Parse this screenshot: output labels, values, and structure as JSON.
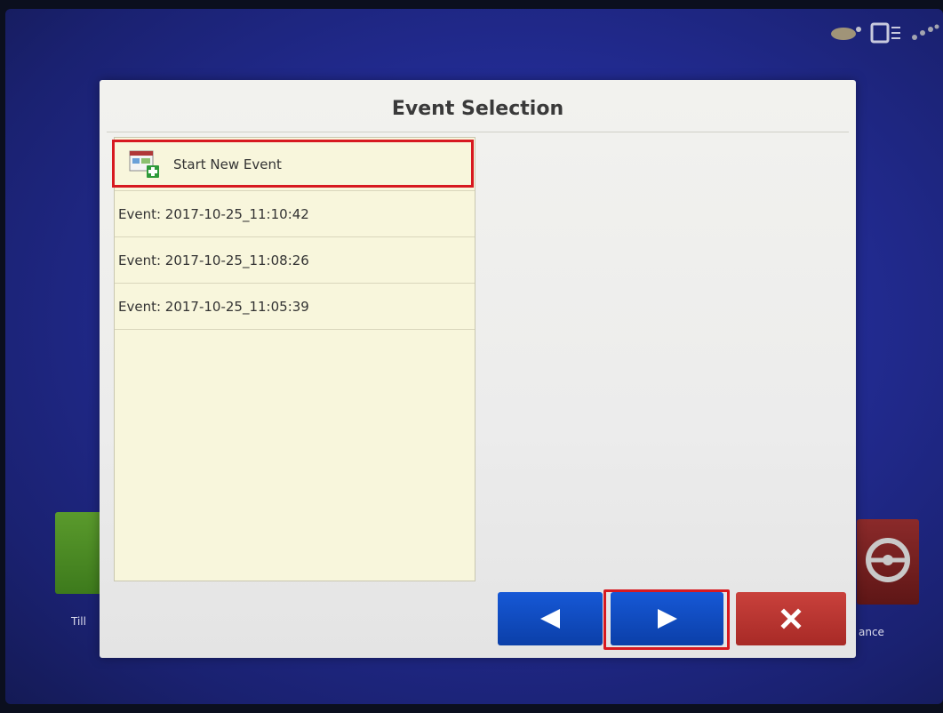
{
  "dialog": {
    "title": "Event Selection",
    "start_new_label": "Start New Event",
    "events": [
      "Event: 2017-10-25_11:10:42",
      "Event: 2017-10-25_11:08:26",
      "Event: 2017-10-25_11:05:39"
    ]
  },
  "buttons": {
    "prev_icon": "left-triangle-icon",
    "next_icon": "right-triangle-icon",
    "close_icon": "close-x-icon"
  },
  "background": {
    "left_tile_label": "Till",
    "right_tile_label": "ance"
  },
  "colors": {
    "screen_bg": "#222b92",
    "list_bg": "#f8f6dc",
    "nav_button": "#1658d6",
    "close_button": "#c9413c",
    "highlight": "#d71920"
  }
}
